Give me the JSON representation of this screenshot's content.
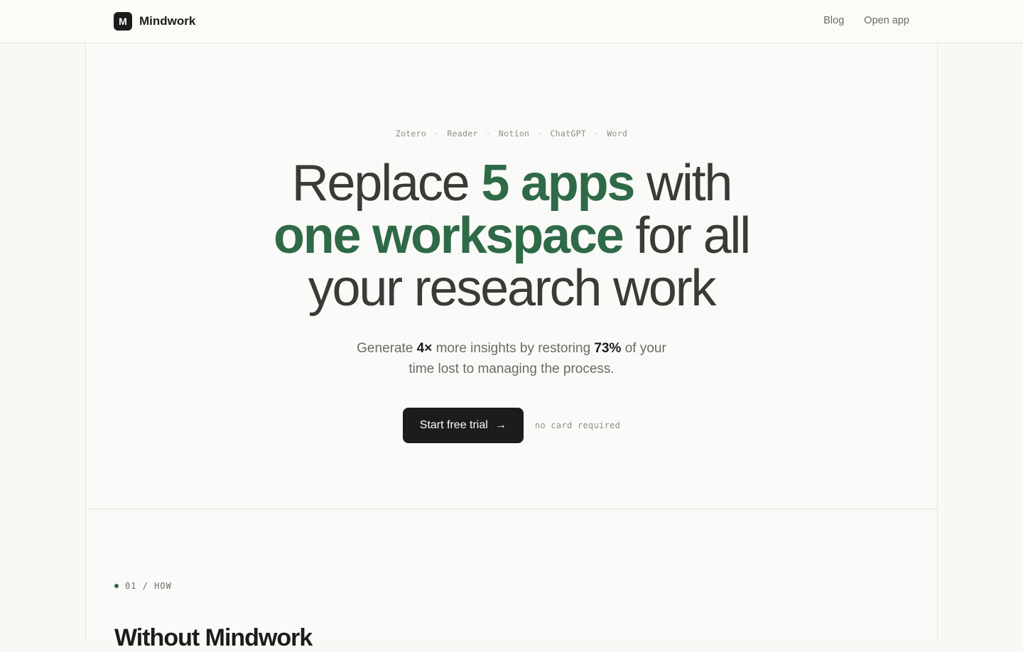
{
  "header": {
    "logo_letter": "M",
    "brand_name": "Mindwork",
    "nav": [
      {
        "label": "Blog"
      },
      {
        "label": "Open app"
      }
    ]
  },
  "hero": {
    "apps": [
      "Zotero",
      "Reader",
      "Notion",
      "ChatGPT",
      "Word"
    ],
    "apps_separator": "·",
    "headline": {
      "l1_a": "Replace ",
      "l1_accent": "5 apps",
      "l1_b": " with",
      "l2_accent": "one workspace",
      "l2_b": " for all",
      "l3": "your research work"
    },
    "subtitle": {
      "p1": "Generate ",
      "b1": "4×",
      "p2": " more insights by restoring ",
      "b2": "73%",
      "p3": " of your",
      "p4": "time lost to managing the process."
    },
    "cta": {
      "label": "Start free trial",
      "arrow": "→",
      "note": "no card required"
    }
  },
  "section": {
    "label": "01 / HOW",
    "title": "Without Mindwork"
  },
  "colors": {
    "accent": "#2f6a48",
    "dark": "#1c1c1a",
    "background": "#f8f8f5"
  }
}
